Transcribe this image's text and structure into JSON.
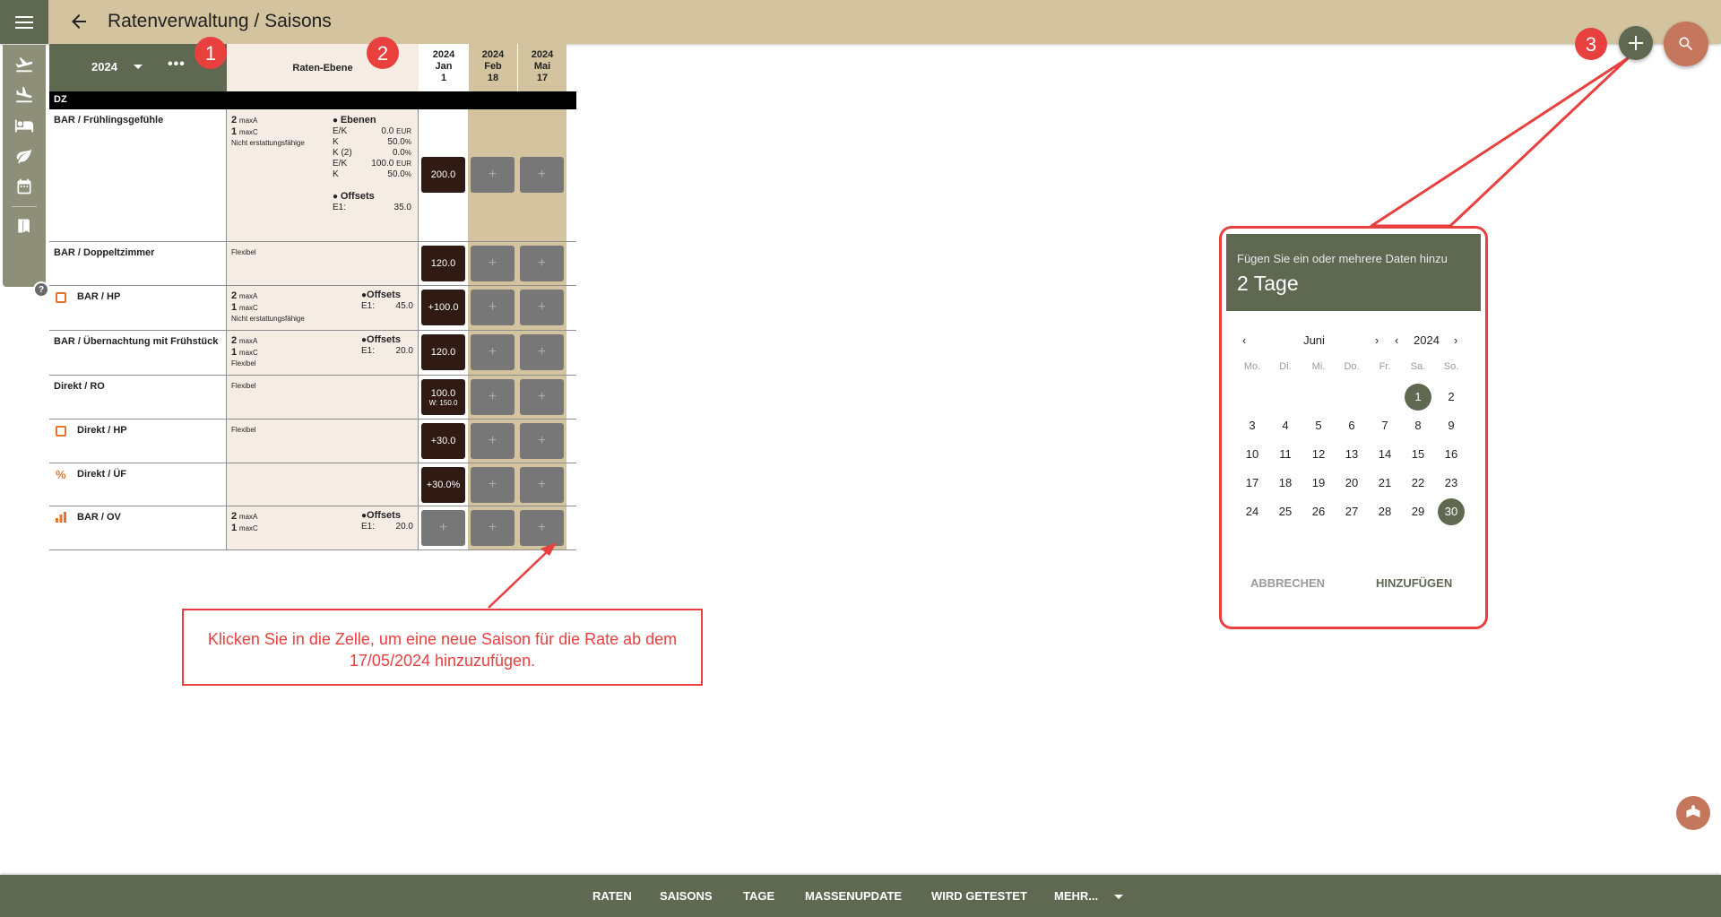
{
  "header": {
    "title": "Ratenverwaltung / Saisons"
  },
  "grid": {
    "year": "2024",
    "more_label": "•••",
    "level_header": "Raten-Ebene",
    "columns": [
      {
        "year": "2024",
        "month": "Jan",
        "day": "1"
      },
      {
        "year": "2024",
        "month": "Feb",
        "day": "18"
      },
      {
        "year": "2024",
        "month": "Mai",
        "day": "17"
      }
    ],
    "group": "DZ",
    "add_symbol": "+",
    "rows": [
      {
        "name": "BAR / Frühlingsgefühle",
        "a": "2",
        "a_unit": "maxA",
        "c": "1",
        "c_unit": "maxC",
        "policy": "Nicht erstattungsfähige",
        "ebenen_title": "Ebenen",
        "ebenen": [
          [
            "E/K",
            "0.0",
            "EUR"
          ],
          [
            "K",
            "50.0",
            "%"
          ],
          [
            "K (2)",
            "0.0",
            "%"
          ],
          [
            "E/K",
            "100.0",
            "EUR"
          ],
          [
            "K",
            "50.0",
            "%"
          ]
        ],
        "offsets_title": "Offsets",
        "offsets": [
          [
            "E1:",
            "35.0"
          ]
        ],
        "value": "200.0"
      },
      {
        "name": "BAR / Doppeltzimmer",
        "policy": "Flexibel",
        "value": "120.0"
      },
      {
        "name": "BAR / HP",
        "a": "2",
        "a_unit": "maxA",
        "c": "1",
        "c_unit": "maxC",
        "policy": "Nicht erstattungsfähige",
        "offsets_title": "Offsets",
        "offsets": [
          [
            "E1:",
            "45.0"
          ]
        ],
        "value": "+100.0"
      },
      {
        "name": "BAR / Übernachtung mit Frühstück",
        "a": "2",
        "a_unit": "maxA",
        "c": "1",
        "c_unit": "maxC",
        "policy": "Flexibel",
        "offsets_title": "Offsets",
        "offsets": [
          [
            "E1:",
            "20.0"
          ]
        ],
        "value": "120.0"
      },
      {
        "name": "Direkt / RO",
        "policy": "Flexibel",
        "value": "100.0",
        "value_sub": "W: 150.0"
      },
      {
        "name": "Direkt / HP",
        "policy": "Flexibel",
        "value": "+30.0"
      },
      {
        "name": "Direkt / ÜF",
        "value": "+30.0%"
      },
      {
        "name": "BAR / OV",
        "a": "2",
        "a_unit": "maxA",
        "c": "1",
        "c_unit": "maxC",
        "offsets_title": "Offsets",
        "offsets": [
          [
            "E1:",
            "20.0"
          ]
        ]
      }
    ]
  },
  "annotations": {
    "b1": "1",
    "b2": "2",
    "b3": "3",
    "box_text": "Klicken Sie in die Zelle, um eine neue Saison für die Rate ab dem 17/05/2024 hinzuzufügen."
  },
  "datepicker": {
    "subtitle": "Fügen Sie ein oder mehrere Daten hinzu",
    "title": "2 Tage",
    "month": "Juni",
    "year": "2024",
    "weekdays": [
      "Mo.",
      "Di.",
      "Mi.",
      "Do.",
      "Fr.",
      "Sa.",
      "So."
    ],
    "days": [
      "1",
      "2",
      "3",
      "4",
      "5",
      "6",
      "7",
      "8",
      "9",
      "10",
      "11",
      "12",
      "13",
      "14",
      "15",
      "16",
      "17",
      "18",
      "19",
      "20",
      "21",
      "22",
      "23",
      "24",
      "25",
      "26",
      "27",
      "28",
      "29",
      "30"
    ],
    "cancel": "ABBRECHEN",
    "add": "HINZUFÜGEN"
  },
  "bottom_tabs": [
    "RATEN",
    "SAISONS",
    "TAGE",
    "MASSENUPDATE",
    "WIRD GETESTET",
    "MEHR..."
  ],
  "colors": {
    "olive": "#5f6952",
    "sand": "#d3c49f",
    "cream": "#f5ede4",
    "dark_cell": "#2f1a14",
    "accent_red": "#e8403e",
    "terracotta": "#c5775d"
  },
  "help": "?"
}
